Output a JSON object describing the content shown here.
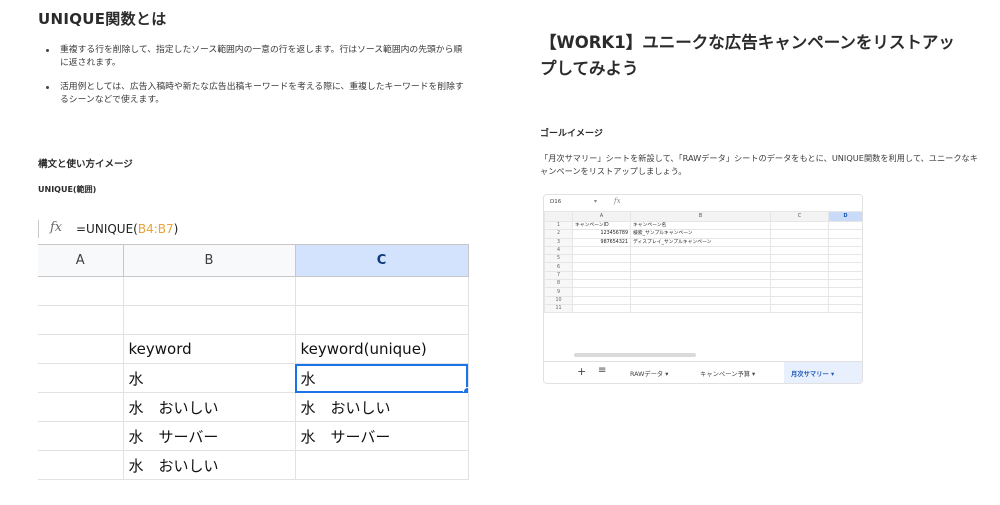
{
  "left": {
    "heading": "UNIQUE関数とは",
    "bullets": [
      "重複する行を削除して、指定したソース範囲内の一意の行を返します。行はソース範囲内の先頭から順に返されます。",
      "活用例としては、広告入稿時や新たな広告出稿キーワードを考える際に、重複したキーワードを削除するシーンなどで使えます。"
    ],
    "subheading": "構文と使い方イメージ",
    "syntax": "UNIQUE(範囲)",
    "sheet": {
      "fx_icon": "fx-icon",
      "formula_prefix": "=UNIQUE(",
      "formula_range": "B4:B7",
      "formula_suffix": ")",
      "columns": [
        "A",
        "B",
        "C"
      ],
      "selected_column": "C",
      "rows": [
        [
          "",
          "",
          ""
        ],
        [
          "",
          "",
          ""
        ],
        [
          "",
          "keyword",
          "keyword(unique)"
        ],
        [
          "",
          "水",
          "水"
        ],
        [
          "",
          "水　おいしい",
          "水　おいしい"
        ],
        [
          "",
          "水　サーバー",
          "水　サーバー"
        ],
        [
          "",
          "水　おいしい",
          ""
        ]
      ],
      "active_color": "#1a73e8"
    }
  },
  "right": {
    "heading": "【WORK1】ユニークな広告キャンペーンをリストアップしてみよう",
    "goal_label": "ゴールイメージ",
    "description": "「月次サマリー」シートを新設して、「RAWデータ」シートのデータをもとに、UNIQUE関数を利用して、ユニークなキャンペーンをリストアップしましょう。",
    "mini_sheet": {
      "cell_ref": "D16",
      "columns": [
        "",
        "A",
        "B",
        "C",
        "D"
      ],
      "selected_column": "D",
      "rows": [
        [
          "1",
          "キャンペーンID",
          "キャンペーン名",
          "",
          ""
        ],
        [
          "2",
          "123456789",
          "検索_サンプルキャンペーン",
          "",
          ""
        ],
        [
          "3",
          "987654321",
          "ディスプレイ_サンプルキャンペーン",
          "",
          ""
        ],
        [
          "4",
          "",
          "",
          "",
          ""
        ],
        [
          "5",
          "",
          "",
          "",
          ""
        ],
        [
          "6",
          "",
          "",
          "",
          ""
        ],
        [
          "7",
          "",
          "",
          "",
          ""
        ],
        [
          "8",
          "",
          "",
          "",
          ""
        ],
        [
          "9",
          "",
          "",
          "",
          ""
        ],
        [
          "10",
          "",
          "",
          "",
          ""
        ],
        [
          "11",
          "",
          "",
          "",
          ""
        ]
      ],
      "tabs": [
        {
          "label": "RAWデータ ▾",
          "active": false
        },
        {
          "label": "キャンペーン予算 ▾",
          "active": false
        },
        {
          "label": "月次サマリー ▾",
          "active": true
        }
      ],
      "add_icon": "plus-icon",
      "menu_icon": "list-icon"
    }
  }
}
